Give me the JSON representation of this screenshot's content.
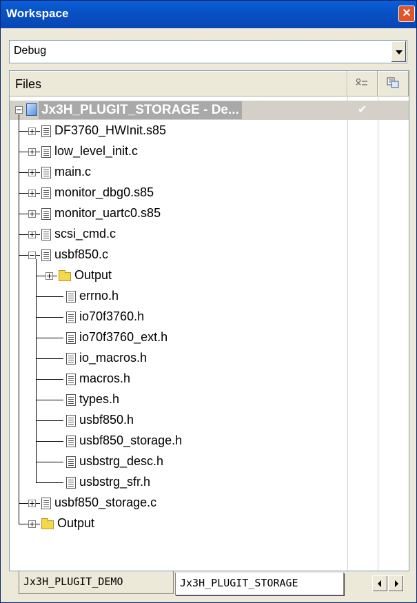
{
  "window": {
    "title": "Workspace",
    "close_glyph": "✕"
  },
  "config": {
    "selected": "Debug"
  },
  "header": {
    "files_label": "Files",
    "col1_icon": "make-status-icon",
    "col2_icon": "options-icon"
  },
  "project": {
    "label": "Jx3H_PLUGIT_STORAGE - De...",
    "check": "✔"
  },
  "tree": [
    {
      "label": "DF3760_HWInit.s85",
      "type": "file",
      "expander": "plus",
      "level": 1
    },
    {
      "label": "low_level_init.c",
      "type": "file",
      "expander": "plus",
      "level": 1
    },
    {
      "label": "main.c",
      "type": "file",
      "expander": "plus",
      "level": 1
    },
    {
      "label": "monitor_dbg0.s85",
      "type": "file",
      "expander": "plus",
      "level": 1
    },
    {
      "label": "monitor_uartc0.s85",
      "type": "file",
      "expander": "plus",
      "level": 1
    },
    {
      "label": "scsi_cmd.c",
      "type": "file",
      "expander": "plus",
      "level": 1
    },
    {
      "label": "usbf850.c",
      "type": "file",
      "expander": "minus",
      "level": 1
    },
    {
      "label": "Output",
      "type": "folder",
      "expander": "plus",
      "level": 2
    },
    {
      "label": "errno.h",
      "type": "file",
      "expander": "none",
      "level": 2
    },
    {
      "label": "io70f3760.h",
      "type": "file",
      "expander": "none",
      "level": 2
    },
    {
      "label": "io70f3760_ext.h",
      "type": "file",
      "expander": "none",
      "level": 2
    },
    {
      "label": "io_macros.h",
      "type": "file",
      "expander": "none",
      "level": 2
    },
    {
      "label": "macros.h",
      "type": "file",
      "expander": "none",
      "level": 2
    },
    {
      "label": "types.h",
      "type": "file",
      "expander": "none",
      "level": 2
    },
    {
      "label": "usbf850.h",
      "type": "file",
      "expander": "none",
      "level": 2
    },
    {
      "label": "usbf850_storage.h",
      "type": "file",
      "expander": "none",
      "level": 2
    },
    {
      "label": "usbstrg_desc.h",
      "type": "file",
      "expander": "none",
      "level": 2
    },
    {
      "label": "usbstrg_sfr.h",
      "type": "file",
      "expander": "none",
      "level": 2
    },
    {
      "label": "usbf850_storage.c",
      "type": "file",
      "expander": "plus",
      "level": 1
    },
    {
      "label": "Output",
      "type": "folder",
      "expander": "plus",
      "level": 1
    }
  ],
  "tabs": [
    {
      "label": "Jx3H_PLUGIT_DEMO",
      "active": false
    },
    {
      "label": "Jx3H_PLUGIT_STORAGE",
      "active": true
    }
  ]
}
